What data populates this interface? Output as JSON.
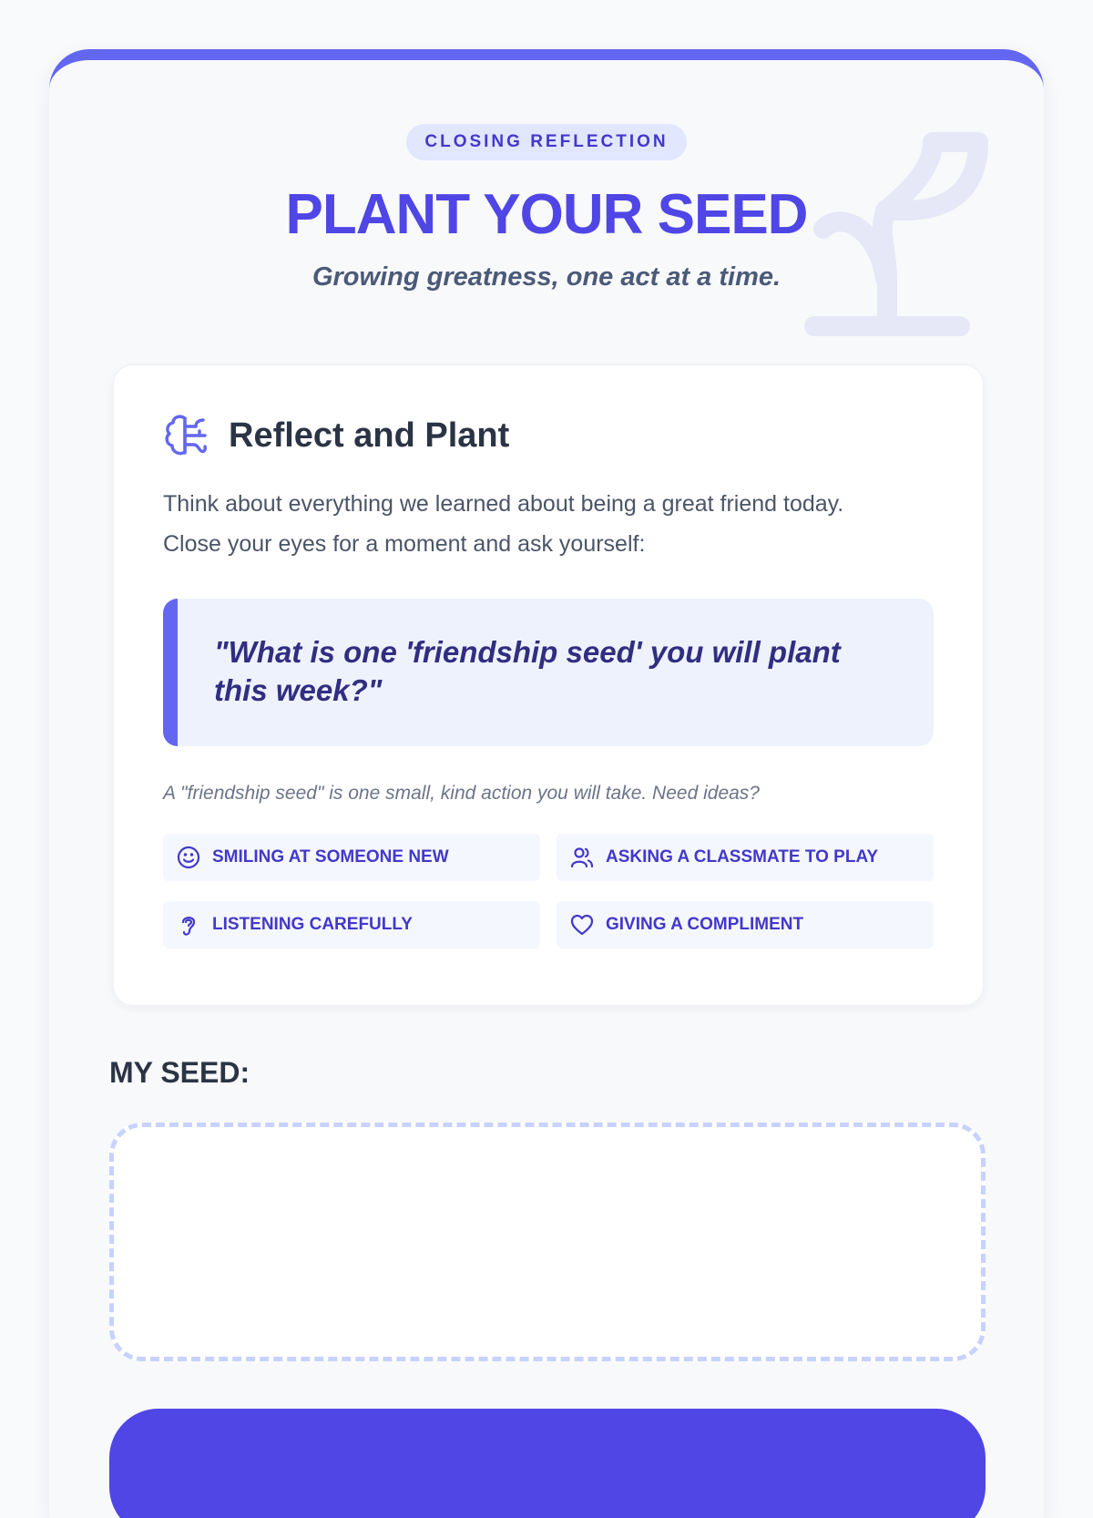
{
  "header": {
    "badge": "CLOSING REFLECTION",
    "title": "PLANT YOUR SEED",
    "subtitle": "Growing greatness, one act at a time."
  },
  "reflect": {
    "title": "Reflect and Plant",
    "intro_line1": "Think about everything we learned about being a great friend today.",
    "intro_line2": "Close your eyes for a moment and ask yourself:",
    "question_line1": "\"What is one 'friendship seed' you will plant",
    "question_line2": "this week?\"",
    "hint": "A \"friendship seed\" is one small, kind action you will take. Need ideas?",
    "ideas": [
      {
        "icon": "smile-icon",
        "label": "SMILING AT SOMEONE NEW"
      },
      {
        "icon": "users-icon",
        "label": "ASKING A CLASSMATE TO PLAY"
      },
      {
        "icon": "ear-icon",
        "label": "LISTENING CAREFULLY"
      },
      {
        "icon": "heart-icon",
        "label": "GIVING A COMPLIMENT"
      }
    ]
  },
  "seed": {
    "label": "MY SEED:",
    "value": ""
  },
  "colors": {
    "accent": "#6366f1",
    "primary": "#4f46e5",
    "badge_bg": "#e0e7ff",
    "quote_bg": "#eef2fd",
    "chip_bg": "#f5f7fe"
  }
}
